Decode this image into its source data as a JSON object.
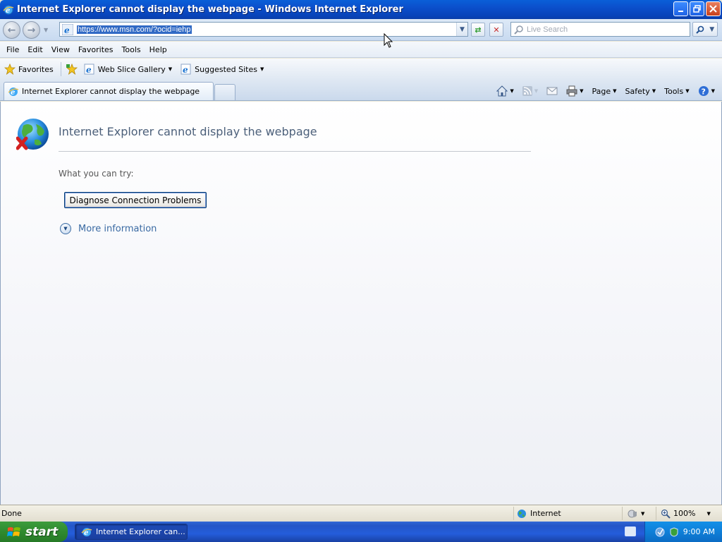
{
  "window": {
    "title": "Internet Explorer cannot display the webpage - Windows Internet Explorer"
  },
  "address": {
    "url": "https://www.msn.com/?ocid=iehp",
    "search_placeholder": "Live Search"
  },
  "menu": [
    "File",
    "Edit",
    "View",
    "Favorites",
    "Tools",
    "Help"
  ],
  "favorites_bar": {
    "favorites_label": "Favorites",
    "items": [
      "Web Slice Gallery",
      "Suggested Sites"
    ]
  },
  "tab": {
    "label": "Internet Explorer cannot display the webpage"
  },
  "command_bar": {
    "page": "Page",
    "safety": "Safety",
    "tools": "Tools"
  },
  "content": {
    "title": "Internet Explorer cannot display the webpage",
    "try_label": "What you can try:",
    "diagnose_button": "Diagnose Connection Problems",
    "more_info": "More information"
  },
  "status": {
    "text": "Done",
    "zone": "Internet",
    "zoom": "100%"
  },
  "taskbar": {
    "start": "start",
    "task": "Internet Explorer can...",
    "clock": "9:00 AM"
  },
  "colors": {
    "titlebar": "#0b4fcb",
    "url_highlight": "#316ac5",
    "error_title": "#4c607a",
    "link": "#3a6aa3",
    "start_green": "#2f8a2f"
  }
}
